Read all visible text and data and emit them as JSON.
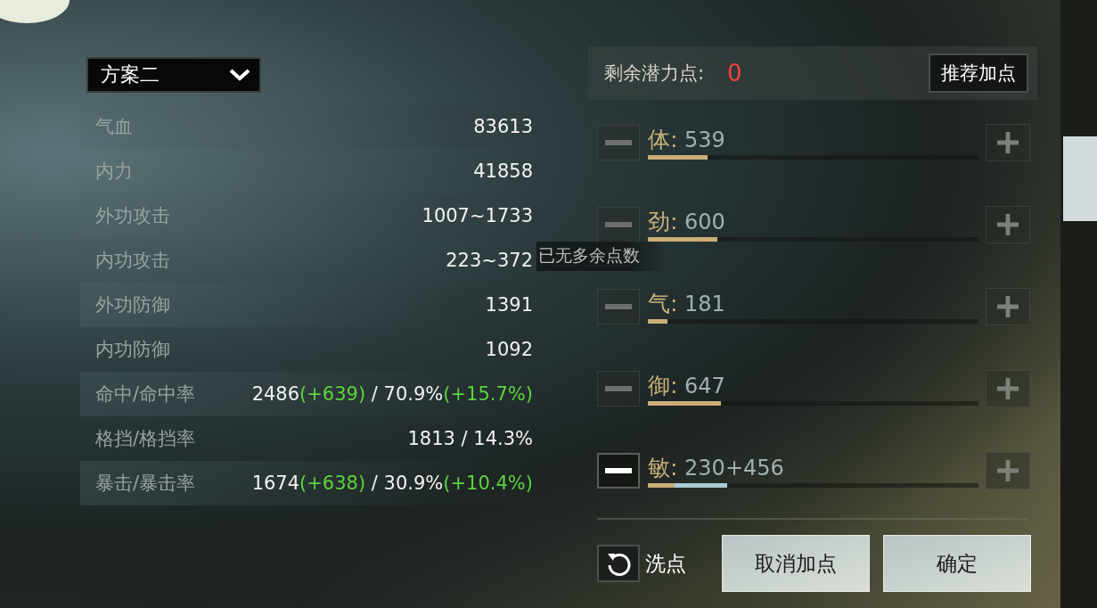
{
  "plan_dropdown": {
    "value": "方案二"
  },
  "stats": [
    {
      "label": "气血",
      "value": [
        {
          "text": "83613",
          "kind": "base"
        }
      ]
    },
    {
      "label": "内力",
      "value": [
        {
          "text": "41858",
          "kind": "base"
        }
      ]
    },
    {
      "label": "外功攻击",
      "value": [
        {
          "text": "1007~1733",
          "kind": "base"
        }
      ]
    },
    {
      "label": "内功攻击",
      "value": [
        {
          "text": "223~372",
          "kind": "base"
        }
      ]
    },
    {
      "label": "外功防御",
      "value": [
        {
          "text": "1391",
          "kind": "base"
        }
      ]
    },
    {
      "label": "内功防御",
      "value": [
        {
          "text": "1092",
          "kind": "base"
        }
      ]
    },
    {
      "label": "命中/命中率",
      "value": [
        {
          "text": "2486",
          "kind": "base"
        },
        {
          "text": "(+639)",
          "kind": "bonus"
        },
        {
          "text": " / 70.9%",
          "kind": "base"
        },
        {
          "text": "(+15.7%)",
          "kind": "bonus"
        }
      ]
    },
    {
      "label": "格挡/格挡率",
      "value": [
        {
          "text": "1813 / 14.3%",
          "kind": "base"
        }
      ]
    },
    {
      "label": "暴击/暴击率",
      "value": [
        {
          "text": "1674",
          "kind": "base"
        },
        {
          "text": "(+638)",
          "kind": "bonus"
        },
        {
          "text": " / 30.9%",
          "kind": "base"
        },
        {
          "text": "(+10.4%)",
          "kind": "bonus"
        }
      ]
    }
  ],
  "tooltip": "已无多余点数",
  "potential": {
    "label": "剩余潜力点:",
    "value": "0",
    "button": "推荐加点"
  },
  "attributes": [
    {
      "name": "体:",
      "value": "539",
      "level": 0.18,
      "minus_disabled": true
    },
    {
      "name": "劲:",
      "value": "600",
      "level": 0.21,
      "minus_disabled": true
    },
    {
      "name": "气:",
      "value": "181",
      "level": 0.06,
      "minus_disabled": true
    },
    {
      "name": "御:",
      "value": "647",
      "level": 0.22,
      "minus_disabled": true
    },
    {
      "name": "敏:",
      "value": "230",
      "added": {
        "text": "+456",
        "level": 0.16
      },
      "level": 0.08,
      "minus_disabled": false
    }
  ],
  "reset": {
    "label": "洗点"
  },
  "buttons": [
    "取消加点",
    "确定"
  ]
}
